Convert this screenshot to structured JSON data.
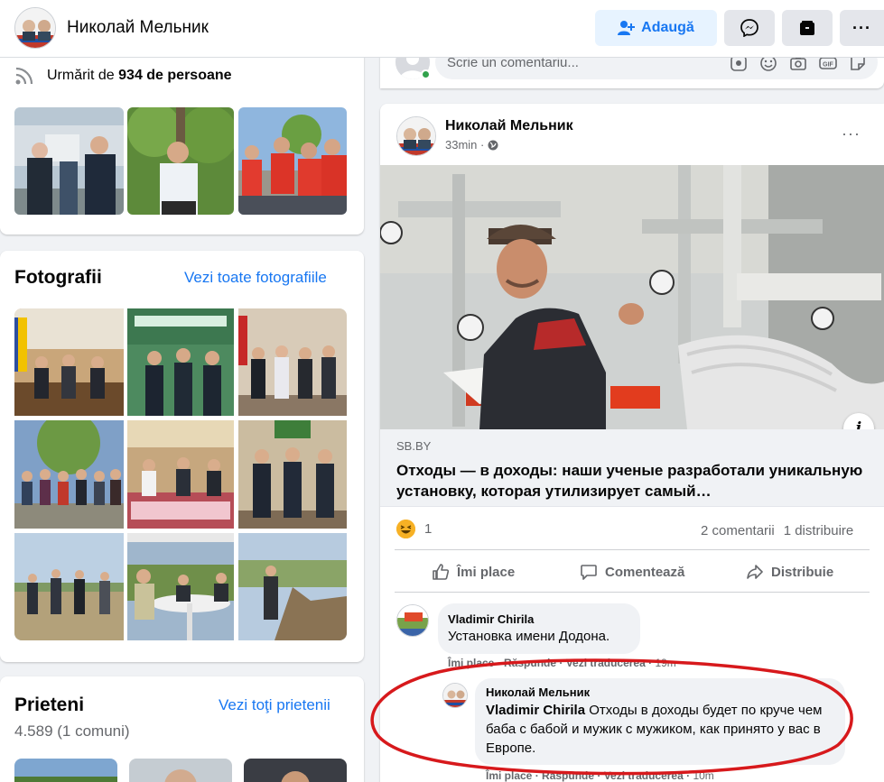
{
  "header": {
    "profile_name": "Николай Мельник",
    "add_label": "Adaugă",
    "icons": [
      "user-plus-icon",
      "messenger-icon",
      "archive-icon",
      "more-icon"
    ]
  },
  "intro": {
    "follow_prefix": "Urmărit de",
    "follow_count": "934 de persoane"
  },
  "photos": {
    "title": "Fotografii",
    "link": "Vezi toate fotografiile"
  },
  "friends": {
    "title": "Prieteni",
    "link": "Vezi toţi prietenii",
    "count": "4.589 (1 comuni)"
  },
  "comment_box": {
    "placeholder": "Scrie un comentariu..."
  },
  "post": {
    "author": "Николай Мельник",
    "time": "33min ·",
    "more": "···",
    "link_domain": "SB.BY",
    "link_title": "Отходы — в доходы: наши ученые разработали уникальную установку, которая утилизирует самый…",
    "info": "i",
    "reaction_count": "1",
    "comments_count": "2 comentarii",
    "shares_count": "1 distribuire",
    "actions": {
      "like": "Îmi place",
      "comment": "Comentează",
      "share": "Distribuie"
    }
  },
  "comments": [
    {
      "author": "Vladimir Chirila",
      "text": "Установка имени Додона.",
      "like": "Îmi place",
      "reply": "Răspunde",
      "translate": "Vezi traducerea",
      "time": "19m"
    },
    {
      "author": "Николай Мельник",
      "mention": "Vladimir Chirila",
      "text": "Отходы в доходы будет по круче чем баба с бабой и мужик с мужиком, как принято у вас в Европе.",
      "like": "Îmi place",
      "reply": "Răspunde",
      "translate": "Vezi traducerea",
      "time": "10m"
    }
  ],
  "colors": {
    "accent": "#1877f2",
    "annotation_red": "#d7191c"
  }
}
